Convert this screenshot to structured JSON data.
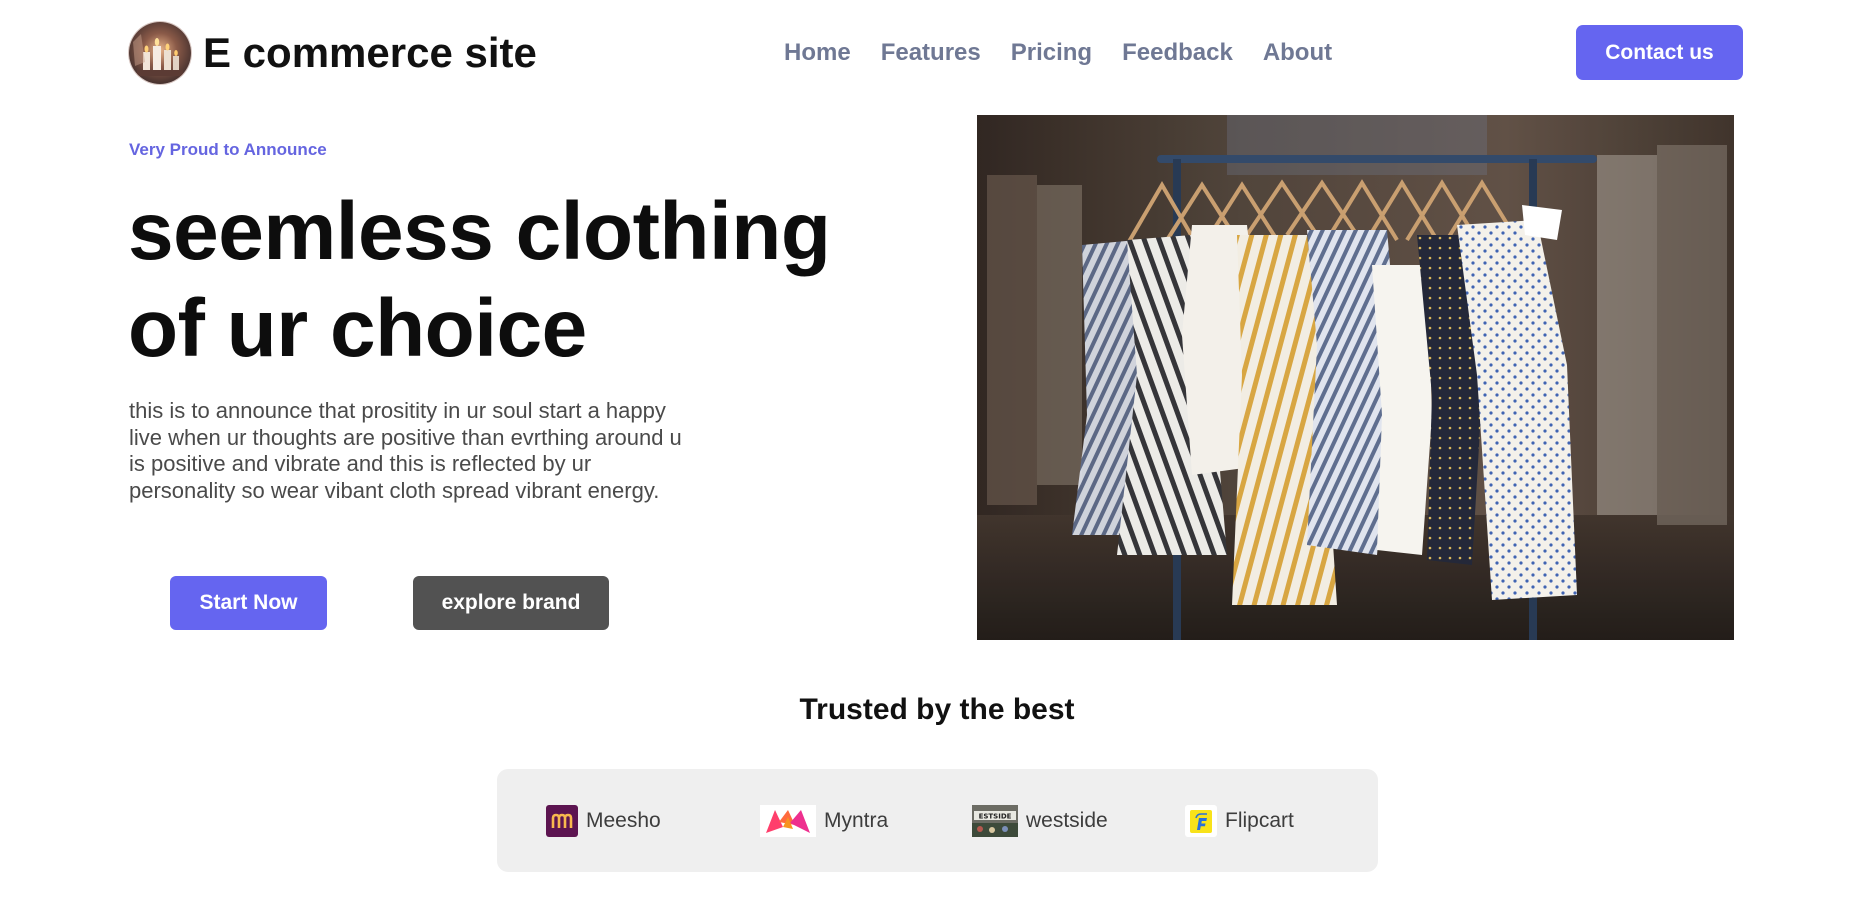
{
  "header": {
    "site_title": "E commerce site",
    "logo_icon": "candles-logo-icon",
    "nav": [
      {
        "label": "Home"
      },
      {
        "label": "Features"
      },
      {
        "label": "Pricing"
      },
      {
        "label": "Feedback"
      },
      {
        "label": "About"
      }
    ],
    "contact_label": "Contact us"
  },
  "hero": {
    "eyebrow": "Very Proud to Announce",
    "title_line1": "seemless clothing",
    "title_line2": "of ur choice",
    "body": "this is to announce that prositity in ur soul start a happy live when ur thoughts are positive than evrthing around u is positive and vibrate and this is reflected by ur personality so wear vibant cloth spread vibrant energy.",
    "start_label": "Start Now",
    "explore_label": "explore brand",
    "image_icon": "clothing-rack-photo"
  },
  "trusted": {
    "title": "Trusted by the best",
    "brands": [
      {
        "name": "Meesho",
        "icon": "meesho-logo-icon"
      },
      {
        "name": "Myntra",
        "icon": "myntra-logo-icon"
      },
      {
        "name": "westside",
        "icon": "westside-logo-icon"
      },
      {
        "name": "Flipcart",
        "icon": "flipkart-logo-icon"
      }
    ]
  },
  "colors": {
    "accent": "#6565f0",
    "nav_text": "#6f7894",
    "secondary_button": "#525252",
    "brand_bar": "#efefef"
  }
}
